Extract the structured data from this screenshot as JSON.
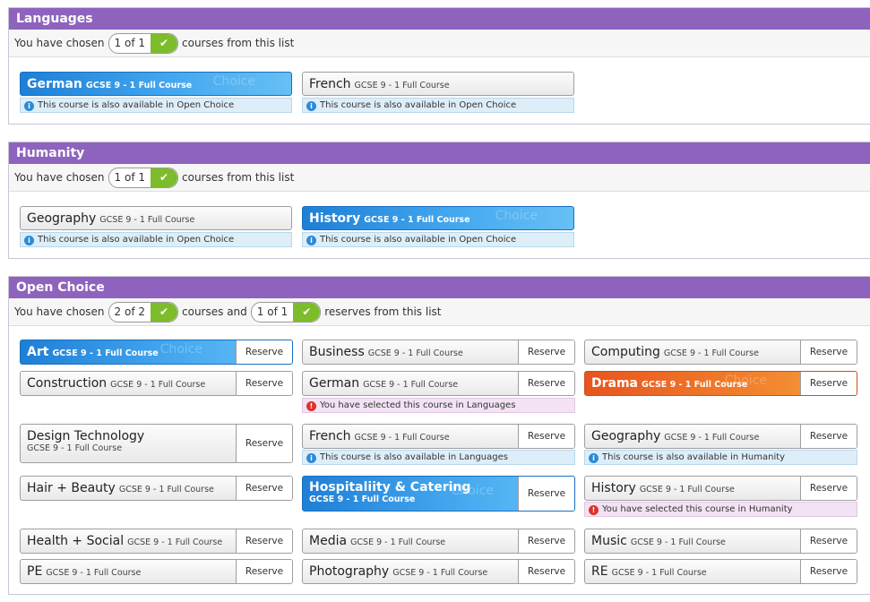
{
  "languages": {
    "title": "Languages",
    "sub_prefix": "You have chosen",
    "pill": "1 of 1",
    "sub_suffix": "courses from this list",
    "courses": [
      {
        "name": "German",
        "detail": "GCSE 9 - 1 Full Course",
        "note": "This course is also available in Open Choice",
        "watermark": "Choice"
      },
      {
        "name": "French",
        "detail": "GCSE 9 - 1 Full Course",
        "note": "This course is also available in Open Choice"
      }
    ]
  },
  "humanity": {
    "title": "Humanity",
    "sub_prefix": "You have chosen",
    "pill": "1 of 1",
    "sub_suffix": "courses from this list",
    "courses": [
      {
        "name": "Geography",
        "detail": "GCSE 9 - 1 Full Course",
        "note": "This course is also available in Open Choice"
      },
      {
        "name": "History",
        "detail": "GCSE 9 - 1 Full Course",
        "note": "This course is also available in Open Choice",
        "watermark": "Choice"
      }
    ]
  },
  "open_choice": {
    "title": "Open Choice",
    "sub_prefix": "You have chosen",
    "pill_courses": "2 of 2",
    "sub_middle": "courses and",
    "pill_reserves": "1 of 1",
    "sub_suffix": "reserves from this list",
    "reserve_label": "Reserve",
    "courses": [
      {
        "name": "Art",
        "detail": "GCSE 9 - 1 Full Course",
        "watermark": "Choice"
      },
      {
        "name": "Business",
        "detail": "GCSE 9 - 1 Full Course"
      },
      {
        "name": "Computing",
        "detail": "GCSE 9 - 1 Full Course"
      },
      {
        "name": "Construction",
        "detail": "GCSE 9 - 1 Full Course"
      },
      {
        "name": "German",
        "detail": "GCSE 9 - 1 Full Course",
        "warning": "You have selected this course in Languages"
      },
      {
        "name": "Drama",
        "detail": "GCSE 9 - 1 Full Course",
        "watermark": "Choice"
      },
      {
        "name": "Design Technology",
        "detail": "GCSE 9 - 1 Full Course"
      },
      {
        "name": "French",
        "detail": "GCSE 9 - 1 Full Course",
        "note": "This course is also available in Languages"
      },
      {
        "name": "Geography",
        "detail": "GCSE 9 - 1 Full Course",
        "note": "This course is also available in Humanity"
      },
      {
        "name": "Hair + Beauty",
        "detail": "GCSE 9 - 1 Full Course"
      },
      {
        "name": "Hospitaliity & Catering",
        "detail": "GCSE 9 - 1 Full Course",
        "watermark": "Choice"
      },
      {
        "name": "History",
        "detail": "GCSE 9 - 1 Full Course",
        "warning": "You have selected this course in Humanity"
      },
      {
        "name": "Health + Social",
        "detail": "GCSE 9 - 1 Full Course"
      },
      {
        "name": "Media",
        "detail": "GCSE 9 - 1 Full Course"
      },
      {
        "name": "Music",
        "detail": "GCSE 9 - 1 Full Course"
      },
      {
        "name": "PE",
        "detail": "GCSE 9 - 1 Full Course"
      },
      {
        "name": "Photography",
        "detail": "GCSE 9 - 1 Full Course"
      },
      {
        "name": "RE",
        "detail": "GCSE 9 - 1 Full Course"
      }
    ]
  },
  "colors": {
    "header": "#8e63bd",
    "selected_blue": "#2a8de0",
    "selected_orange": "#ee6a26",
    "check_green": "#7dbc2a"
  },
  "icons": {
    "info": "info-icon",
    "warning": "warning-icon",
    "check": "check-icon"
  }
}
